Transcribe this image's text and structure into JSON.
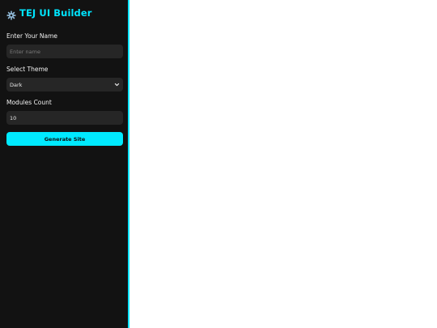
{
  "app": {
    "title": "TEJ UI Builder",
    "brand_icon": "gear-icon",
    "accent_color": "#00e5ff"
  },
  "form": {
    "name": {
      "label": "Enter Your Name",
      "placeholder": "Enter name",
      "value": ""
    },
    "theme": {
      "label": "Select Theme",
      "selected": "Dark",
      "icon": "chevron-down-icon"
    },
    "modules": {
      "label": "Modules Count",
      "value": "10"
    },
    "generate_label": "Generate Site"
  }
}
